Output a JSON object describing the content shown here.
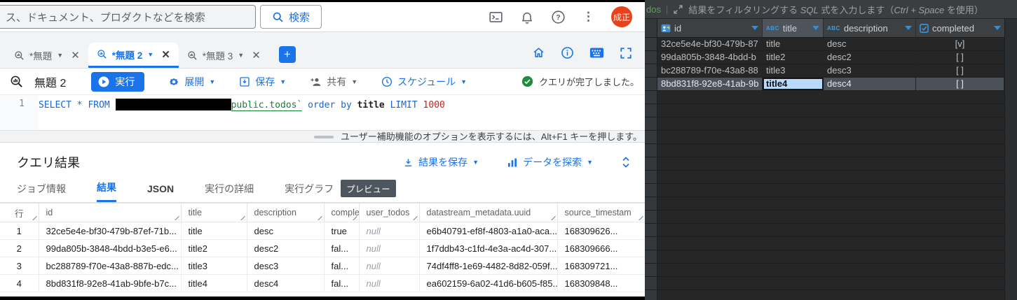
{
  "topbar": {
    "search_text": "ス、ドキュメント、プロダクトなどを検索",
    "search_button": "検索",
    "avatar_initials": "成正"
  },
  "tabs": {
    "tab1": "*無題",
    "tab2": "*無題 2",
    "tab3": "*無題 3"
  },
  "toolbar": {
    "query_title": "無題 2",
    "run": "実行",
    "expand": "展開",
    "save": "保存",
    "share": "共有",
    "schedule": "スケジュール",
    "status": "クエリが完了しました。"
  },
  "sql": {
    "line_no": "1",
    "kw1": "SELECT * FROM ",
    "table_ref": "public.todos`",
    "kw2": " order by ",
    "col": "title",
    "kw3": " LIMIT ",
    "num": "1000"
  },
  "editor": {
    "a11y_hint": "ユーザー補助機能のオプションを表示するには、Alt+F1 キーを押します。"
  },
  "results": {
    "heading": "クエリ結果",
    "save_results": "結果を保存",
    "explore": "データを探索",
    "tab_job": "ジョブ情報",
    "tab_results": "結果",
    "tab_json": "JSON",
    "tab_details": "実行の詳細",
    "tab_graph": "実行グラフ",
    "preview_badge": "プレビュー",
    "headers": [
      "行",
      "id",
      "title",
      "description",
      "comple",
      "user_todos",
      "datastream_metadata.uuid",
      "source_timestam"
    ],
    "rows": [
      [
        "1",
        "32ce5e4e-bf30-479b-87ef-71b...",
        "title",
        "desc",
        "true",
        "null",
        "e6b40791-ef8f-4803-a1a0-aca...",
        "168309626..."
      ],
      [
        "2",
        "99da805b-3848-4bdd-b3e5-e6...",
        "title2",
        "desc2",
        "fal...",
        "null",
        "1f7ddb43-c1fd-4e3a-ac4d-307...",
        "168309666..."
      ],
      [
        "3",
        "bc288789-f70e-43a8-887b-edc...",
        "title3",
        "desc3",
        "fal...",
        "null",
        "74df4ff8-1e69-4482-8d82-059f...",
        "168309721..."
      ],
      [
        "4",
        "8bd831f8-92e8-41ab-9bfe-b7c...",
        "title4",
        "desc4",
        "fal...",
        "null",
        "ea602159-6a02-41d6-b605-f85...",
        "168309848..."
      ]
    ]
  },
  "sidepanel": {
    "table_name": "dos",
    "hint": {
      "p1": "結果をフィルタリングする ",
      "p2": "SQL",
      "p3": " 式を入力します（",
      "p4": "Ctrl + Space",
      "p5": " を使用）"
    },
    "columns": {
      "id": "id",
      "title": "title",
      "description": "description",
      "completed": "completed"
    },
    "rows": [
      [
        "32ce5e4e-bf30-479b-87",
        "title",
        "desc",
        "[v]"
      ],
      [
        "99da805b-3848-4bdd-b",
        "title2",
        "desc2",
        "[ ]"
      ],
      [
        "bc288789-f70e-43a8-88",
        "title3",
        "desc3",
        "[ ]"
      ],
      [
        "8bd831f8-92e8-41ab-9b",
        "title4",
        "desc4",
        "[ ]"
      ]
    ]
  }
}
